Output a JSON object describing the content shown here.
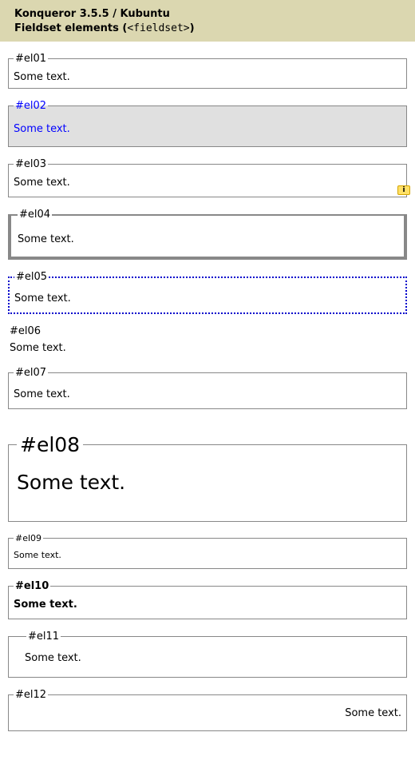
{
  "header": {
    "title": "Konqueror 3.5.5 / Kubuntu",
    "subtitle_prefix": "Fieldset elements (",
    "subtitle_code": "<fieldset>",
    "subtitle_suffix": ")"
  },
  "badge": {
    "text": "i"
  },
  "fieldsets": {
    "el01": {
      "legend": "#el01",
      "text": "Some text."
    },
    "el02": {
      "legend": "#el02",
      "text": "Some text."
    },
    "el03": {
      "legend": "#el03",
      "text": "Some text."
    },
    "el04": {
      "legend": "#el04",
      "text": "Some text."
    },
    "el05": {
      "legend": "#el05",
      "text": "Some text."
    },
    "el06": {
      "legend": "#el06",
      "text": "Some text."
    },
    "el07": {
      "legend": "#el07",
      "text": "Some text."
    },
    "el08": {
      "legend": "#el08",
      "text": "Some text."
    },
    "el09": {
      "legend": "#el09",
      "text": "Some text."
    },
    "el10": {
      "legend": "#el10",
      "text": "Some text."
    },
    "el11": {
      "legend": "#el11",
      "text": "Some text."
    },
    "el12": {
      "legend": "#el12",
      "text": "Some text."
    }
  }
}
